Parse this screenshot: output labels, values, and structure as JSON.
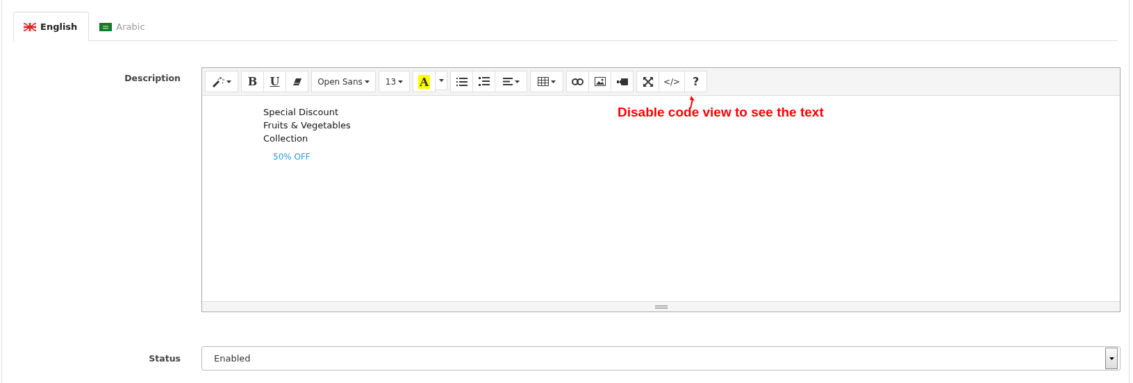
{
  "tabs": [
    {
      "label": "English",
      "selected": true,
      "kind": "uk"
    },
    {
      "label": "Arabic",
      "selected": false,
      "kind": "sa"
    }
  ],
  "description": {
    "label": "Description",
    "toolbar": [
      [
        {
          "kind": "magic"
        }
      ],
      [
        {
          "kind": "bold",
          "label": "B"
        },
        {
          "kind": "underline",
          "label": "U"
        },
        {
          "kind": "eraser"
        }
      ],
      [
        {
          "kind": "font",
          "label": "Open Sans"
        }
      ],
      [
        {
          "kind": "size",
          "label": "13"
        }
      ],
      [
        {
          "kind": "color",
          "label": "A"
        },
        {
          "kind": "caret"
        }
      ],
      [
        {
          "kind": "ul"
        },
        {
          "kind": "ol"
        },
        {
          "kind": "align"
        }
      ],
      [
        {
          "kind": "table"
        }
      ],
      [
        {
          "kind": "link"
        },
        {
          "kind": "image"
        },
        {
          "kind": "video"
        }
      ],
      [
        {
          "kind": "fullscreen"
        },
        {
          "kind": "code",
          "label": "</>"
        },
        {
          "kind": "help",
          "label": "?"
        }
      ]
    ],
    "lines": [
      "Special Discount",
      "Fruits & Vegetables",
      "Collection"
    ],
    "offer": "50% OFF",
    "annotation": "Disable code view to see the text"
  },
  "status": {
    "label": "Status",
    "value": "Enabled"
  }
}
